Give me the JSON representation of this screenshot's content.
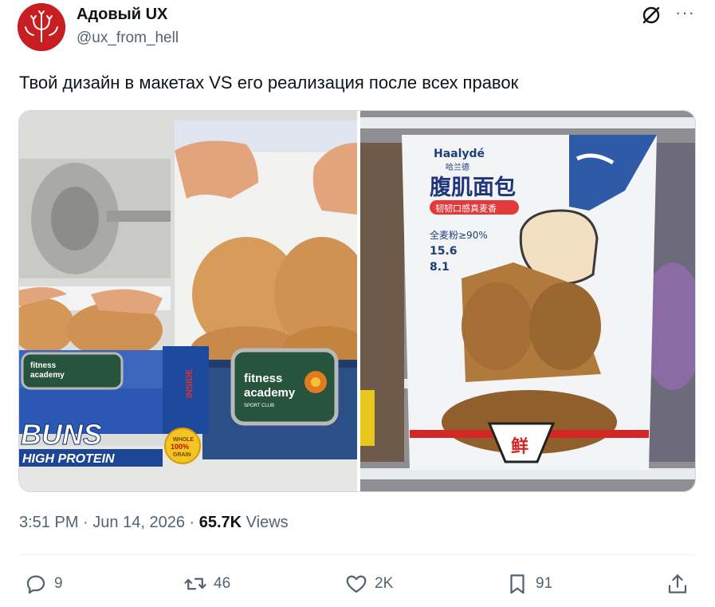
{
  "author": {
    "display_name": "Адовый UX",
    "handle": "@ux_from_hell",
    "avatar_icon": "devil-trident-avatar"
  },
  "header_icons": [
    "grok-icon",
    "more-icon"
  ],
  "tweet": {
    "text": "Твой дизайн в макетах VS его реализация после всех правок"
  },
  "media": {
    "left_image": {
      "box_brand": "fitness academy",
      "box_club": "SPORT CLUB",
      "box_product": "BUNS",
      "box_subtitle": "HIGH PROTEIN",
      "box_side": "INSIDE",
      "box_badge_top": "WHOLE",
      "box_badge_mid": "100%",
      "box_badge_bottom": "GRAIN"
    },
    "right_image": {
      "brand": "Haalydé",
      "brand_cn": "哈兰德",
      "title_cn": "腹肌面包",
      "subtitle_cn": "韧韧口感真麦香",
      "stat1": "全麦粉≥90%",
      "stat2": "15.6",
      "stat3": "8.1",
      "fresh_cn": "鲜"
    }
  },
  "meta": {
    "time": "3:51 PM",
    "sep1": "·",
    "date": "Jun 14, 2026",
    "sep2": "·",
    "views_count": "65.7K",
    "views_label": "Views"
  },
  "actions": {
    "reply": {
      "icon": "reply-icon",
      "count": "9"
    },
    "retweet": {
      "icon": "retweet-icon",
      "count": "46"
    },
    "like": {
      "icon": "heart-icon",
      "count": "2K"
    },
    "bookmark": {
      "icon": "bookmark-icon",
      "count": "91"
    },
    "share": {
      "icon": "share-icon"
    }
  },
  "colors": {
    "avatar_bg": "#c81e22",
    "secondary_text": "#536471",
    "primary_text": "#0f1419"
  }
}
